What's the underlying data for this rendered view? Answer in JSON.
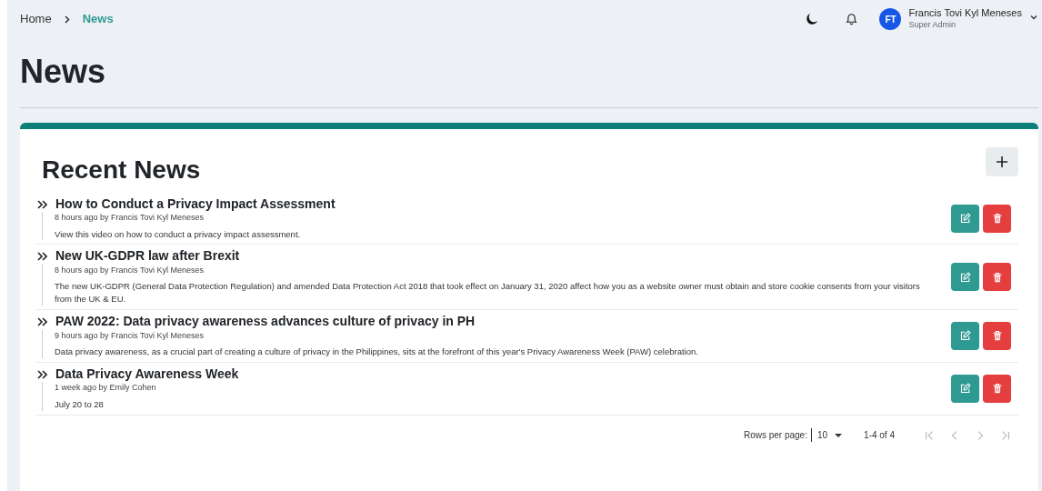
{
  "breadcrumb": [
    {
      "label": "Home",
      "selected": false
    },
    {
      "label": "News",
      "selected": true
    }
  ],
  "user": {
    "initials": "FT",
    "name": "Francis Tovi Kyl Meneses",
    "role": "Super Admin"
  },
  "page_title": "News",
  "card": {
    "title": "Recent News",
    "items": [
      {
        "title": "How to Conduct a Privacy Impact Assessment",
        "meta": "8 hours ago by Francis Tovi Kyl Meneses",
        "body": "View this video on how to conduct a privacy impact assessment."
      },
      {
        "title": "New UK-GDPR law after Brexit",
        "meta": "8 hours ago by Francis Tovi Kyl Meneses",
        "body": "The new UK-GDPR (General Data Protection Regulation) and amended Data Protection Act 2018 that took effect on January 31, 2020 affect how you as a website owner must obtain and store cookie consents from your visitors from the UK & EU."
      },
      {
        "title": "PAW 2022: Data privacy awareness advances culture of privacy in PH",
        "meta": "9 hours ago by Francis Tovi Kyl Meneses",
        "body": "Data privacy awareness, as a crucial part of creating a culture of privacy in the Philippines, sits at the forefront of this year's Privacy Awareness Week (PAW) celebration."
      },
      {
        "title": "Data Privacy Awareness Week",
        "meta": "1 week ago by Emily Cohen",
        "body": "July 20 to 28"
      }
    ]
  },
  "pagination": {
    "rows_label": "Rows per page:",
    "rows_value": "10",
    "range": "1-4 of 4",
    "buttons": [
      {
        "kind": "first",
        "disabled": true
      },
      {
        "kind": "prev",
        "disabled": true
      },
      {
        "kind": "next",
        "disabled": true
      },
      {
        "kind": "last",
        "disabled": true
      }
    ]
  }
}
